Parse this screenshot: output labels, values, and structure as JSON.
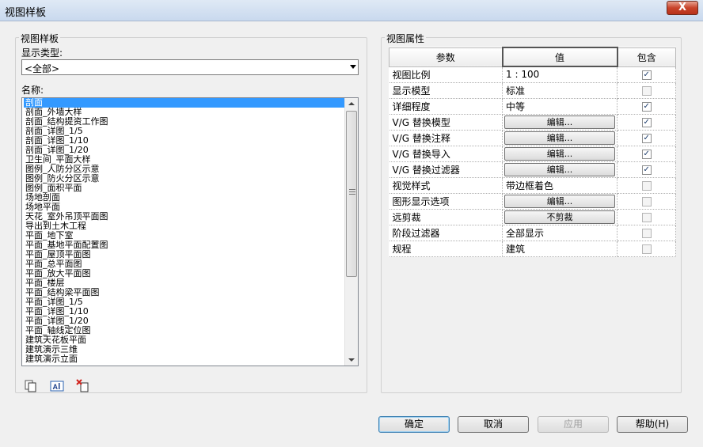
{
  "window": {
    "title": "视图样板",
    "close_symbol": "X"
  },
  "left_group": {
    "label": "视图样板",
    "show_type_label": "显示类型:",
    "show_type_value": "<全部>",
    "names_label": "名称:",
    "items": [
      "剖面",
      "剖面_外墙大样",
      "剖面_结构提资工作图",
      "剖面_详图_1/5",
      "剖面_详图_1/10",
      "剖面_详图_1/20",
      "卫生间_平面大样",
      "图例_人防分区示意",
      "图例_防火分区示意",
      "图例_面积平面",
      "场地剖面",
      "场地平面",
      "天花_室外吊顶平面图",
      "导出到土木工程",
      "平面_地下室",
      "平面_基地平面配置图",
      "平面_屋顶平面图",
      "平面_总平面图",
      "平面_放大平面图",
      "平面_楼层",
      "平面_结构梁平面图",
      "平面_详图_1/5",
      "平面_详图_1/10",
      "平面_详图_1/20",
      "平面_轴线定位图",
      "建筑天花板平面",
      "建筑演示三维",
      "建筑演示立面"
    ],
    "selected_index": 0,
    "tools": {
      "duplicate_icon": "duplicate-icon",
      "rename_icon": "rename-icon",
      "delete_icon": "delete-icon"
    }
  },
  "right_group": {
    "label": "视图属性",
    "columns": [
      "参数",
      "值",
      "包含"
    ],
    "rows": [
      {
        "param": "视图比例",
        "value": "1 : 100",
        "type": "text",
        "include": true
      },
      {
        "param": "显示模型",
        "value": "标准",
        "type": "text",
        "include": false
      },
      {
        "param": "详细程度",
        "value": "中等",
        "type": "text",
        "include": true
      },
      {
        "param": "V/G 替换模型",
        "value": "编辑...",
        "type": "button",
        "include": true
      },
      {
        "param": "V/G 替换注释",
        "value": "编辑...",
        "type": "button",
        "include": true
      },
      {
        "param": "V/G 替换导入",
        "value": "编辑...",
        "type": "button",
        "include": true
      },
      {
        "param": "V/G 替换过滤器",
        "value": "编辑...",
        "type": "button",
        "include": true
      },
      {
        "param": "视觉样式",
        "value": "带边框着色",
        "type": "text",
        "include": false
      },
      {
        "param": "图形显示选项",
        "value": "编辑...",
        "type": "button",
        "include": false
      },
      {
        "param": "远剪裁",
        "value": "不剪裁",
        "type": "button",
        "include": false
      },
      {
        "param": "阶段过滤器",
        "value": "全部显示",
        "type": "text",
        "include": false
      },
      {
        "param": "规程",
        "value": "建筑",
        "type": "text",
        "include": false
      }
    ]
  },
  "buttons": {
    "ok": "确定",
    "cancel": "取消",
    "apply": "应用",
    "help": "帮助(H)"
  }
}
